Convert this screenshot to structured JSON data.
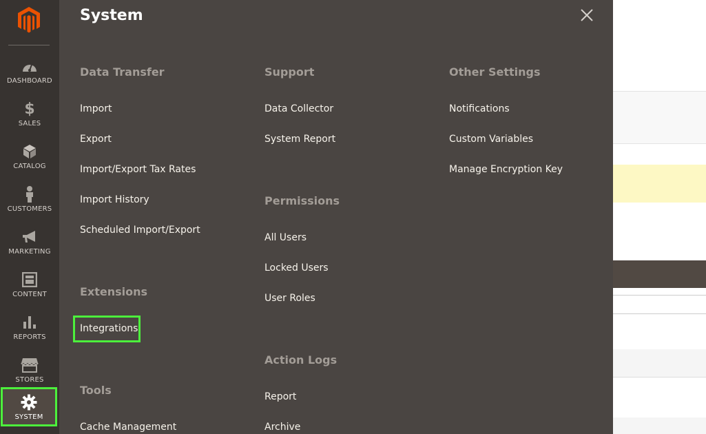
{
  "sidebar": {
    "items": [
      {
        "label": "DASHBOARD",
        "icon": "dashboard-icon"
      },
      {
        "label": "SALES",
        "icon": "dollar-icon"
      },
      {
        "label": "CATALOG",
        "icon": "cube-icon"
      },
      {
        "label": "CUSTOMERS",
        "icon": "person-icon"
      },
      {
        "label": "MARKETING",
        "icon": "megaphone-icon"
      },
      {
        "label": "CONTENT",
        "icon": "layout-icon"
      },
      {
        "label": "REPORTS",
        "icon": "bar-chart-icon"
      },
      {
        "label": "STORES",
        "icon": "storefront-icon"
      },
      {
        "label": "SYSTEM",
        "icon": "gear-icon"
      }
    ],
    "active": "SYSTEM"
  },
  "panel": {
    "title": "System",
    "close_icon": "close-icon",
    "columns": [
      {
        "sections": [
          {
            "title": "Data Transfer",
            "links": [
              "Import",
              "Export",
              "Import/Export Tax Rates",
              "Import History",
              "Scheduled Import/Export"
            ]
          },
          {
            "title": "Extensions",
            "links": [
              "Integrations"
            ]
          },
          {
            "title": "Tools",
            "links": [
              "Cache Management"
            ]
          }
        ]
      },
      {
        "sections": [
          {
            "title": "Support",
            "links": [
              "Data Collector",
              "System Report"
            ]
          },
          {
            "title": "Permissions",
            "links": [
              "All Users",
              "Locked Users",
              "User Roles"
            ]
          },
          {
            "title": "Action Logs",
            "links": [
              "Report",
              "Archive"
            ]
          }
        ]
      },
      {
        "sections": [
          {
            "title": "Other Settings",
            "links": [
              "Notifications",
              "Custom Variables",
              "Manage Encryption Key"
            ]
          }
        ]
      }
    ]
  },
  "colors": {
    "sidebar_bg": "#373330",
    "panel_bg": "#4a4542",
    "logo": "#eb5202",
    "highlight": "#4cf03c",
    "notice_bg": "#fdf8c4"
  }
}
